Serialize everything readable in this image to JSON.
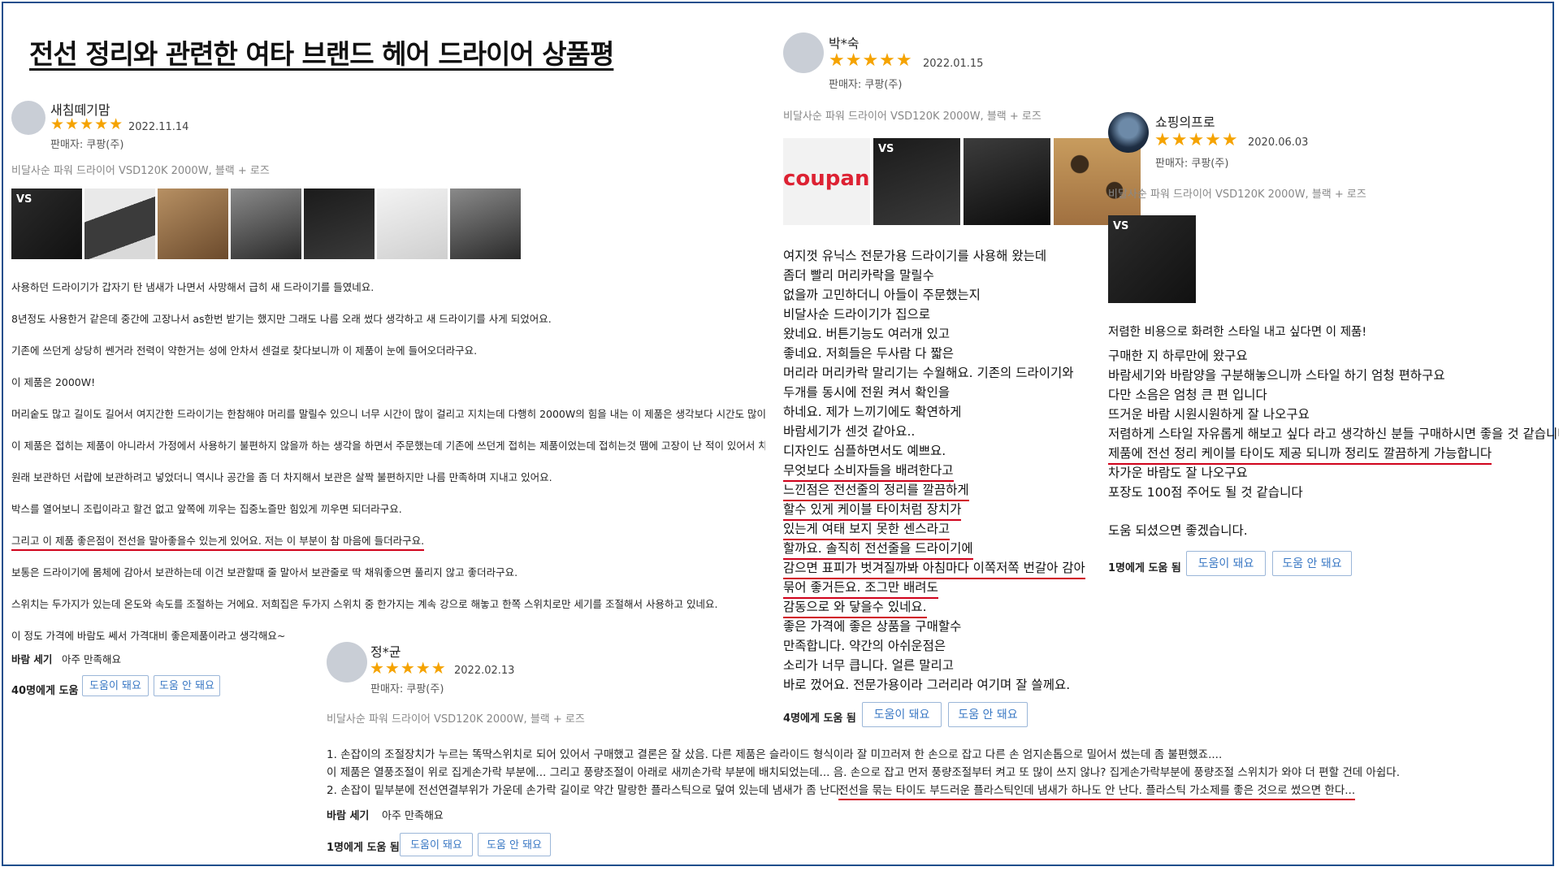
{
  "title": "전선 정리와 관련한 여타 브랜드 헤어 드라이어 상품평",
  "reviews": [
    {
      "author": "새침떼기맘",
      "stars": "★★★★★",
      "date": "2022.11.14",
      "seller": "판매자: 쿠팡(주)",
      "product": "비달사순 파워 드라이어 VSD120K 2000W, 블랙 + 로즈",
      "lines": [
        "사용하던 드라이기가 갑자기 탄 냄새가 나면서 사망해서 급히 새 드라이기를 들였네요.",
        "8년정도 사용한거 같은데 중간에 고장나서 as한번 받기는 했지만 그래도 나름 오래 썼다 생각하고 새 드라이기를 사게 되었어요.",
        "기존에 쓰던게 상당히 쎈거라 전력이 약한거는 성에 안차서 센걸로 찾다보니까 이 제품이 눈에 들어오더라구요.",
        "이 제품은 2000W!",
        "머리숱도 많고 길이도 길어서 여지간한 드라이기는 한참해야 머리를 말릴수 있으니 너무 시간이 많이 걸리고 지치는데 다행히 2000W의 힘을 내는 이 제품은 생각보다 시간도 많이 걸리",
        "이 제품은 접히는 제품이 아니라서 가정에서 사용하기 불편하지 않을까 하는 생각을 하면서 주문했는데 기존에 쓰던게 접히는 제품이었는데 접히는것 땜에 고장이 난 적이 있어서 차라리",
        "원래 보관하던 서랍에 보관하려고 넣었더니 역시나 공간을 좀 더 차지해서 보관은 살짝 불편하지만 나름 만족하며 지내고 있어요.",
        "박스를 열어보니 조립이라고 할건 없고 앞쪽에 끼우는 집중노즐만 힘있게 끼우면 되더라구요.",
        "그리고 이 제품 좋은점이 전선을 말아좋을수 있는게 있어요. 저는 이 부분이 참 마음에 들더라구요.",
        "보통은 드라이기에 몸체에 감아서 보관하는데 이건 보관할때 줄 말아서 보관줄로 딱 채워좋으면 풀리지 않고 좋더라구요.",
        "스위치는 두가지가 있는데 온도와 속도를 조절하는 거에요. 저희집은 두가지 스위치 중 한가지는 계속 강으로 해놓고 한쪽 스위치로만 세기를 조절해서 사용하고 있네요.",
        "이 정도 가격에 바람도 쎄서 가격대비 좋은제품이라고 생각해요~"
      ],
      "attr_label": "바람 세기",
      "attr_value": "아주 만족해요",
      "helpful": "40명에게 도움 됨",
      "btn_yes": "도움이 돼요",
      "btn_no": "도움 안 돼요"
    },
    {
      "author": "정*균",
      "stars": "★★★★★",
      "date": "2022.02.13",
      "seller": "판매자: 쿠팡(주)",
      "product": "비달사순 파워 드라이어 VSD120K 2000W, 블랙 + 로즈",
      "lines": [
        "1. 손잡이의 조절장치가 누르는 똑딱스위치로 되어 있어서 구매했고 결론은 잘 샀음. 다른 제품은 슬라이드 형식이라 잘 미끄러져 한 손으로 잡고 다른 손 엄지손톱으로 밀어서 썼는데 좀 불편했죠....",
        "이 제품은 열풍조절이 위로 집게손가락 부분에... 그리고 풍량조절이 아래로 새끼손가락 부분에 배치되었는데... 음. 손으로 잡고 먼저 풍량조절부터 켜고 또 많이 쓰지 않나? 집게손가락부분에 풍량조절 스위치가 와야 더 편할 건데 아쉽다.",
        "2. 손잡이 밑부분에 전선연결부위가 가운데 손가락 길이로 약간 말랑한 플라스틱으로 덮여 있는데 냄새가 좀 난다.",
        "전선을 묶는 타이도 부드러운 플라스틱인데 냄새가 하나도 안 난다. 플라스틱 가소제를 좋은 것으로 썼으면 한다..."
      ],
      "attr_label": "바람 세기",
      "attr_value": "아주 만족해요",
      "helpful": "1명에게 도움 됨",
      "btn_yes": "도움이 돼요",
      "btn_no": "도움 안 돼요"
    },
    {
      "author": "박*숙",
      "stars": "★★★★★",
      "date": "2022.01.15",
      "seller": "판매자: 쿠팡(주)",
      "product": "비달사순 파워 드라이어 VSD120K 2000W, 블랙 + 로즈",
      "thumb_text": "coupang",
      "lines": [
        "여지껏 유닉스 전문가용 드라이기를 사용해 왔는데",
        "좀더 빨리 머리카락을 말릴수",
        "없을까 고민하더니 아들이 주문했는지",
        "비달사순 드라이기가 집으로",
        "왔네요. 버튼기능도 여러개 있고",
        "좋네요. 저희들은 두사람 다 짧은",
        "머리라 머리카락 말리기는 수월해요. 기존의 드라이기와",
        "두개를 동시에 전원 켜서 확인을",
        "하네요. 제가 느끼기에도 확연하게",
        "바람세기가 센것 같아요..",
        "디자인도 심플하면서도 예쁘요.",
        "무엇보다 소비자들을 배려한다고",
        "느낀점은 전선줄의 정리를 깔끔하게",
        "할수 있게 케이블 타이처럼 장치가",
        "있는게 여태 보지 못한 센스라고",
        "할까요. 솔직히 전선줄을 드라이기에",
        "감으면 표피가 벗겨질까봐 아침마다 이쪽저쪽 번갈아 감아",
        "묶어 좋거든요. 조그만 배려도",
        "감동으로 와 닿을수 있네요.",
        "좋은 가격에 좋은 상품을 구매할수",
        "만족합니다. 약간의 아쉬운점은",
        "소리가 너무 큽니다. 얼른 말리고",
        "바로 껐어요. 전문가용이라 그러리라 여기며 잘 쓸께요."
      ],
      "helpful": "4명에게 도움 됨",
      "btn_yes": "도움이 돼요",
      "btn_no": "도움 안 돼요"
    },
    {
      "author": "쇼핑의프로",
      "stars": "★★★★★",
      "date": "2020.06.03",
      "seller": "판매자: 쿠팡(주)",
      "product": "비달사순 파워 드라이어 VSD120K 2000W, 블랙 + 로즈",
      "lines": [
        "저렴한 비용으로 화려한 스타일 내고 싶다면 이 제품!",
        "구매한 지 하루만에 왔구요",
        "바람세기와 바람양을 구분해놓으니까 스타일 하기 엄청 편하구요",
        "다만 소음은 엄청 큰 편 입니다",
        "뜨거운 바람 시원시원하게 잘 나오구요",
        "저렴하게 스타일 자유롭게 해보고 싶다 라고 생각하신 분들 구매하시면 좋을 것 같습니다.",
        "제품에 전선 정리 케이블 타이도 제공 되니까 정리도 깔끔하게 가능합니다",
        "차가운 바람도 잘 나오구요",
        "포장도 100점 주어도 될 것 같습니다",
        "도움 되셨으면 좋겠습니다."
      ],
      "helpful": "1명에게 도움 됨",
      "btn_yes": "도움이 돼요",
      "btn_no": "도움 안 돼요"
    }
  ],
  "thumb_label": "VS",
  "colors": {
    "star": "#f5a300",
    "underline": "#d0021b",
    "button_text": "#3a78c4",
    "frame": "#1f4e8c"
  }
}
